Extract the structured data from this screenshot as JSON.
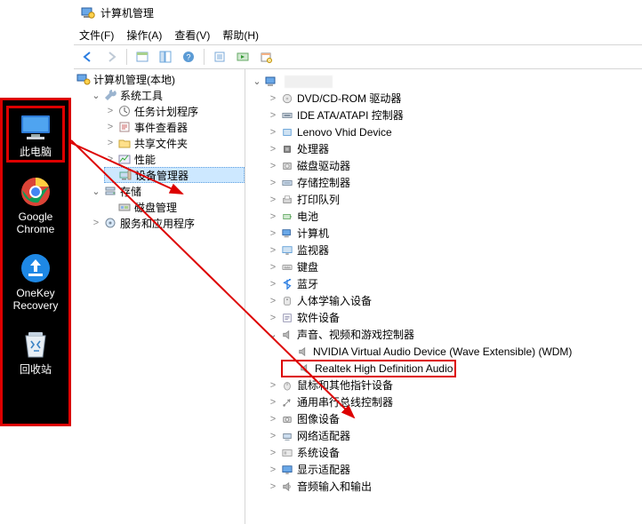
{
  "desktop": {
    "this_pc": "此电脑",
    "chrome_l1": "Google",
    "chrome_l2": "Chrome",
    "onekey_l1": "OneKey",
    "onekey_l2": "Recovery",
    "recycle": "回收站"
  },
  "window": {
    "title": "计算机管理",
    "menu": {
      "file": "文件(F)",
      "action": "操作(A)",
      "view": "查看(V)",
      "help": "帮助(H)"
    }
  },
  "left_tree": {
    "root": "计算机管理(本地)",
    "sys_tools": "系统工具",
    "task": "任务计划程序",
    "event": "事件查看器",
    "shared": "共享文件夹",
    "perf": "性能",
    "devmgr": "设备管理器",
    "storage": "存储",
    "diskmgmt": "磁盘管理",
    "services": "服务和应用程序"
  },
  "right_tree": {
    "dvd": "DVD/CD-ROM 驱动器",
    "ide": "IDE ATA/ATAPI 控制器",
    "lenovo": "Lenovo Vhid Device",
    "cpu": "处理器",
    "disk": "磁盘驱动器",
    "storage_ctrl": "存储控制器",
    "printq": "打印队列",
    "battery": "电池",
    "computer": "计算机",
    "monitor": "监视器",
    "keyboard": "键盘",
    "bluetooth": "蓝牙",
    "hid": "人体学输入设备",
    "software": "软件设备",
    "sound": "声音、视频和游戏控制器",
    "nvidia": "NVIDIA Virtual Audio Device (Wave Extensible) (WDM)",
    "realtek": "Realtek High Definition Audio",
    "mouse": "鼠标和其他指针设备",
    "usb": "通用串行总线控制器",
    "imaging": "图像设备",
    "network": "网络适配器",
    "sysdev": "系统设备",
    "display": "显示适配器",
    "audio_io": "音频输入和输出"
  }
}
